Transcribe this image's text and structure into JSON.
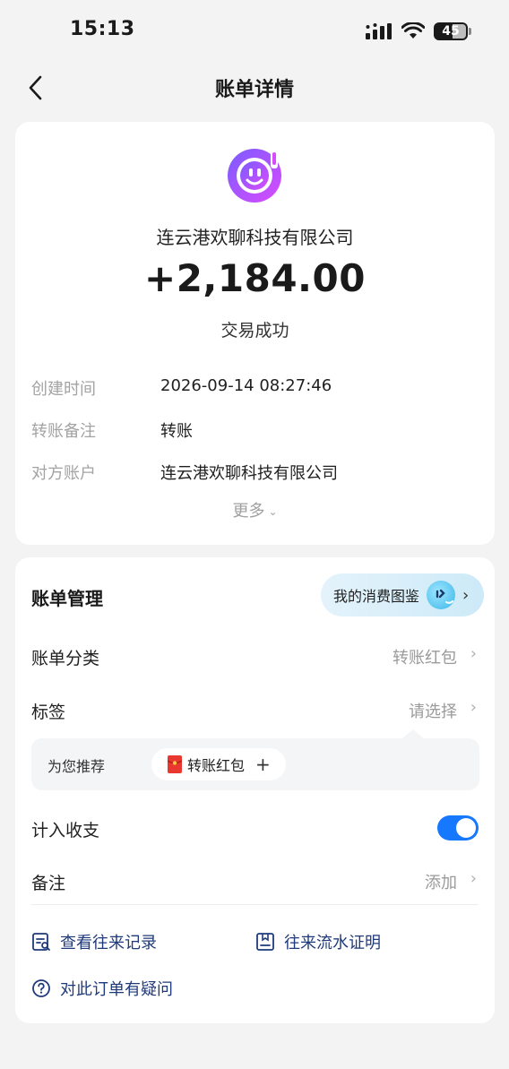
{
  "status": {
    "time": "15:13",
    "battery": "45"
  },
  "nav": {
    "title": "账单详情"
  },
  "bill": {
    "merchant_name": "连云港欢聊科技有限公司",
    "amount": "+2,184.00",
    "status": "交易成功",
    "details": [
      {
        "label": "创建时间",
        "value": "2026-09-14 08:27:46"
      },
      {
        "label": "转账备注",
        "value": "转账"
      },
      {
        "label": "对方账户",
        "value": "连云港欢聊科技有限公司"
      }
    ],
    "more_label": "更多"
  },
  "management": {
    "title": "账单管理",
    "consume_pill": "我的消费图鉴",
    "category_label": "账单分类",
    "category_value": "转账红包",
    "tag_label": "标签",
    "tag_value": "请选择",
    "recommend_label": "为您推荐",
    "recommend_chip": "转账红包",
    "include_label": "计入收支",
    "include_on": true,
    "note_label": "备注",
    "note_value": "添加",
    "links": {
      "records": "查看往来记录",
      "statement": "往来流水证明",
      "question": "对此订单有疑问"
    }
  },
  "colors": {
    "accent": "#1677ff",
    "link": "#1f3a7a"
  }
}
